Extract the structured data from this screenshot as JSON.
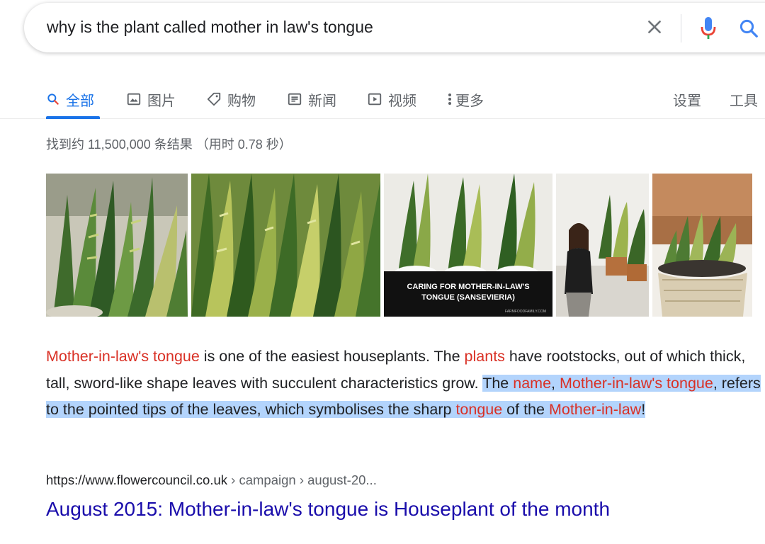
{
  "search": {
    "query": "why is the plant called mother in law's tongue"
  },
  "tabs": [
    {
      "label": "全部",
      "icon": "search-icon"
    },
    {
      "label": "图片",
      "icon": "image-icon"
    },
    {
      "label": "购物",
      "icon": "tag-icon"
    },
    {
      "label": "新闻",
      "icon": "newspaper-icon"
    },
    {
      "label": "视频",
      "icon": "play-icon"
    },
    {
      "label": "更多",
      "icon": "more-vertical-icon"
    }
  ],
  "tools": {
    "settings": "设置",
    "tools": "工具"
  },
  "stats": "找到约 11,500,000 条结果 （用时 0.78 秒）",
  "images": {
    "overlay_caption_line1": "CARING FOR MOTHER-IN-LAW'S",
    "overlay_caption_line2": "TONGUE (SANSEVIERIA)",
    "overlay_site": "FARMFOODFAMILY.COM"
  },
  "snippet": {
    "s1": "Mother-in-law's tongue",
    "s2": " is one of the easiest houseplants. The ",
    "s3": "plants",
    "s4": " have rootstocks, out of which thick, tall, sword-like shape leaves with succulent characteristics grow. ",
    "s5": "The ",
    "s6": "name",
    "s7": ", ",
    "s8": "Mother-in-law's tongue",
    "s9": ", refers to the pointed tips of the leaves, which symbolises the sharp ",
    "s10": "tongue",
    "s11": " of the ",
    "s12": "Mother-in-law",
    "s13": "!"
  },
  "result": {
    "domain": "https://www.flowercouncil.co.uk",
    "crumbs": " › campaign › august-20...",
    "title": "August 2015: Mother-in-law's tongue is Houseplant of the month"
  },
  "colors": {
    "accent": "#1a73e8",
    "keyword_highlight": "#d93025",
    "link": "#1a0dab",
    "selection": "#b3d4fc"
  }
}
